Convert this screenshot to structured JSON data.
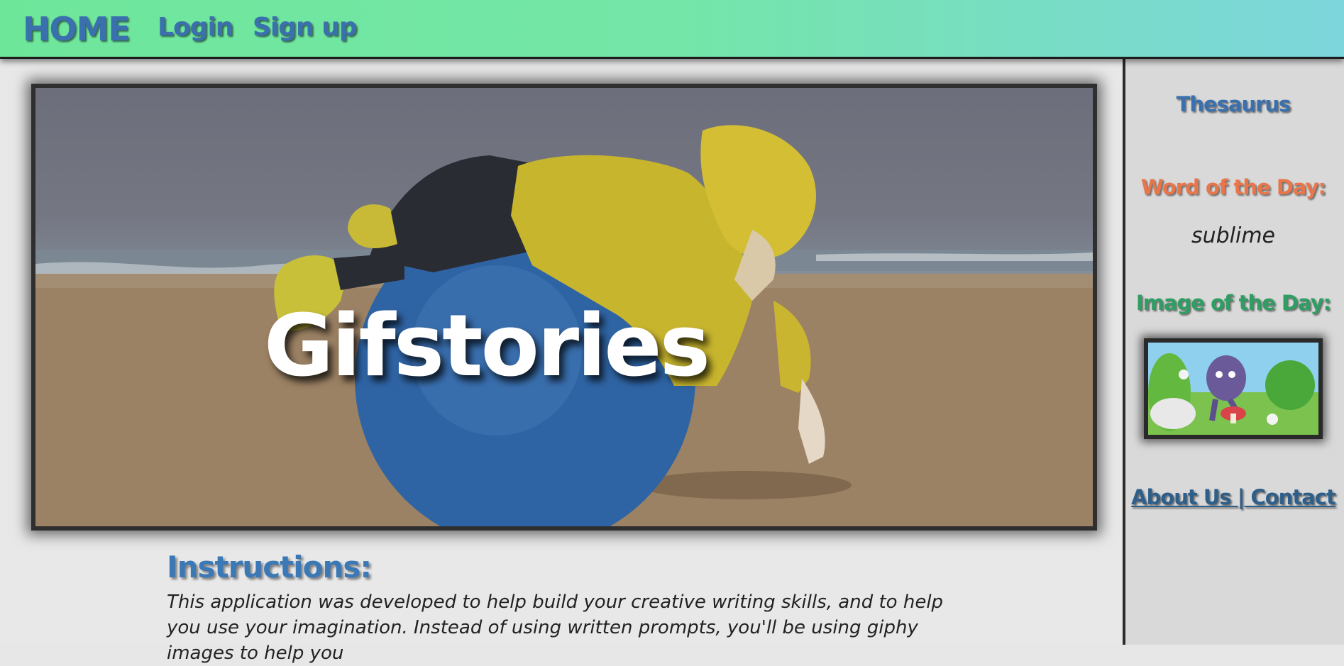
{
  "nav": {
    "home": "HOME",
    "login": "Login",
    "signup": "Sign up"
  },
  "hero": {
    "title": "Gifstories"
  },
  "instructions": {
    "title": "Instructions:",
    "text": "This application was developed to help build your creative writing skills, and to help you use your imagination. Instead of using written prompts, you'll be using giphy images to help you"
  },
  "sidebar": {
    "thesaurus": "Thesaurus",
    "word_of_day_label": "Word of the Day:",
    "word_of_day": "sublime",
    "image_of_day_label": "Image of the Day:",
    "about_contact": "About Us | Contact"
  },
  "colors": {
    "nav_link": "#3a70ad",
    "word_label": "#e8764a",
    "image_label": "#2f9e63",
    "instructions_title": "#3b78b6"
  }
}
